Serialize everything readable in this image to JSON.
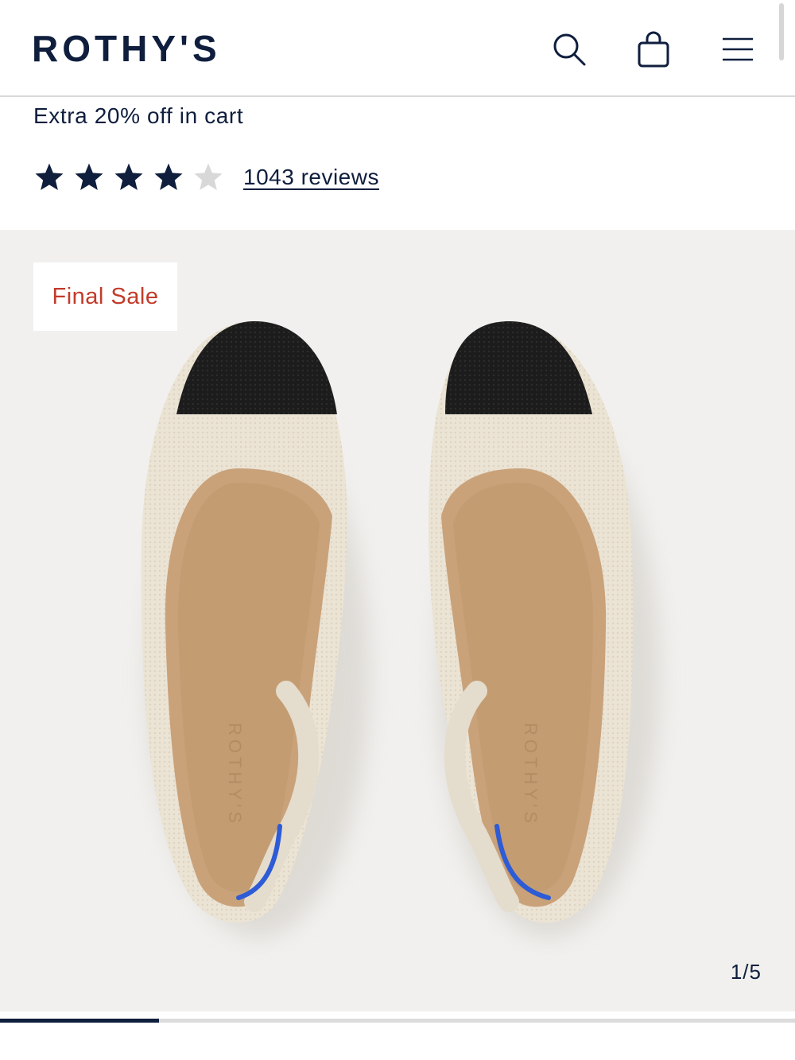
{
  "header": {
    "brand": "ROTHY'S",
    "icons": [
      "search-icon",
      "shopping-bag-icon",
      "hamburger-menu-icon"
    ]
  },
  "promo": {
    "text": "Extra 20% off in cart"
  },
  "rating": {
    "stars_filled": 4,
    "stars_total": 5,
    "reviews_label": "1043 reviews"
  },
  "gallery": {
    "badge": "Final Sale",
    "counter": "1/5",
    "current_index": 1,
    "total_images": 5,
    "insole_brand_mark": "ROTHY'S"
  },
  "colors": {
    "navy": "#0f1e3d",
    "sale_red": "#c23b2a",
    "gallery_bg": "#f1f0ee",
    "star_empty": "#d8d8d8"
  }
}
